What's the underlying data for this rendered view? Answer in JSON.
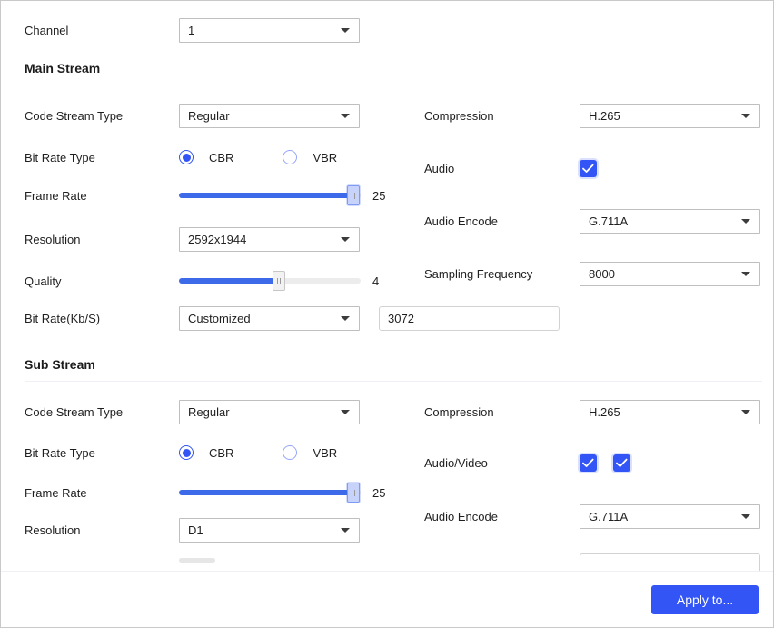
{
  "channel_row": {
    "label": "Channel",
    "value": "1",
    "caret_icon": "chevron-down-icon"
  },
  "main_stream": {
    "title": "Main Stream",
    "left": {
      "code_stream_type": {
        "label": "Code Stream Type",
        "value": "Regular"
      },
      "bit_rate_type": {
        "label": "Bit Rate Type",
        "options": [
          "CBR",
          "VBR"
        ],
        "selected": "CBR"
      },
      "frame_rate": {
        "label": "Frame Rate",
        "value": "25",
        "percent": 96
      },
      "resolution": {
        "label": "Resolution",
        "value": "2592x1944"
      },
      "quality": {
        "label": "Quality",
        "value": "4",
        "percent": 55
      },
      "bit_rate": {
        "label": "Bit Rate(Kb/S)",
        "value": "Customized",
        "custom_value": "3072"
      }
    },
    "right": {
      "compression": {
        "label": "Compression",
        "value": "H.265"
      },
      "audio": {
        "label": "Audio",
        "checked": true
      },
      "audio_encode": {
        "label": "Audio Encode",
        "value": "G.711A"
      },
      "sampling_frequency": {
        "label": "Sampling Frequency",
        "value": "8000"
      }
    }
  },
  "sub_stream": {
    "title": "Sub Stream",
    "left": {
      "code_stream_type": {
        "label": "Code Stream Type",
        "value": "Regular"
      },
      "bit_rate_type": {
        "label": "Bit Rate Type",
        "options": [
          "CBR",
          "VBR"
        ],
        "selected": "CBR"
      },
      "frame_rate": {
        "label": "Frame Rate",
        "value": "25",
        "percent": 96
      },
      "resolution": {
        "label": "Resolution",
        "value": "D1"
      }
    },
    "right": {
      "compression": {
        "label": "Compression",
        "value": "H.265"
      },
      "audio_video": {
        "label": "Audio/Video",
        "audio_checked": true,
        "video_checked": true
      },
      "audio_encode": {
        "label": "Audio Encode",
        "value": "G.711A"
      }
    }
  },
  "footer": {
    "apply_label": "Apply to..."
  },
  "colors": {
    "accent": "#3355f5",
    "slider_fill": "#3d6ae8",
    "border": "#bfbfbf",
    "rule": "#eef0f6"
  }
}
